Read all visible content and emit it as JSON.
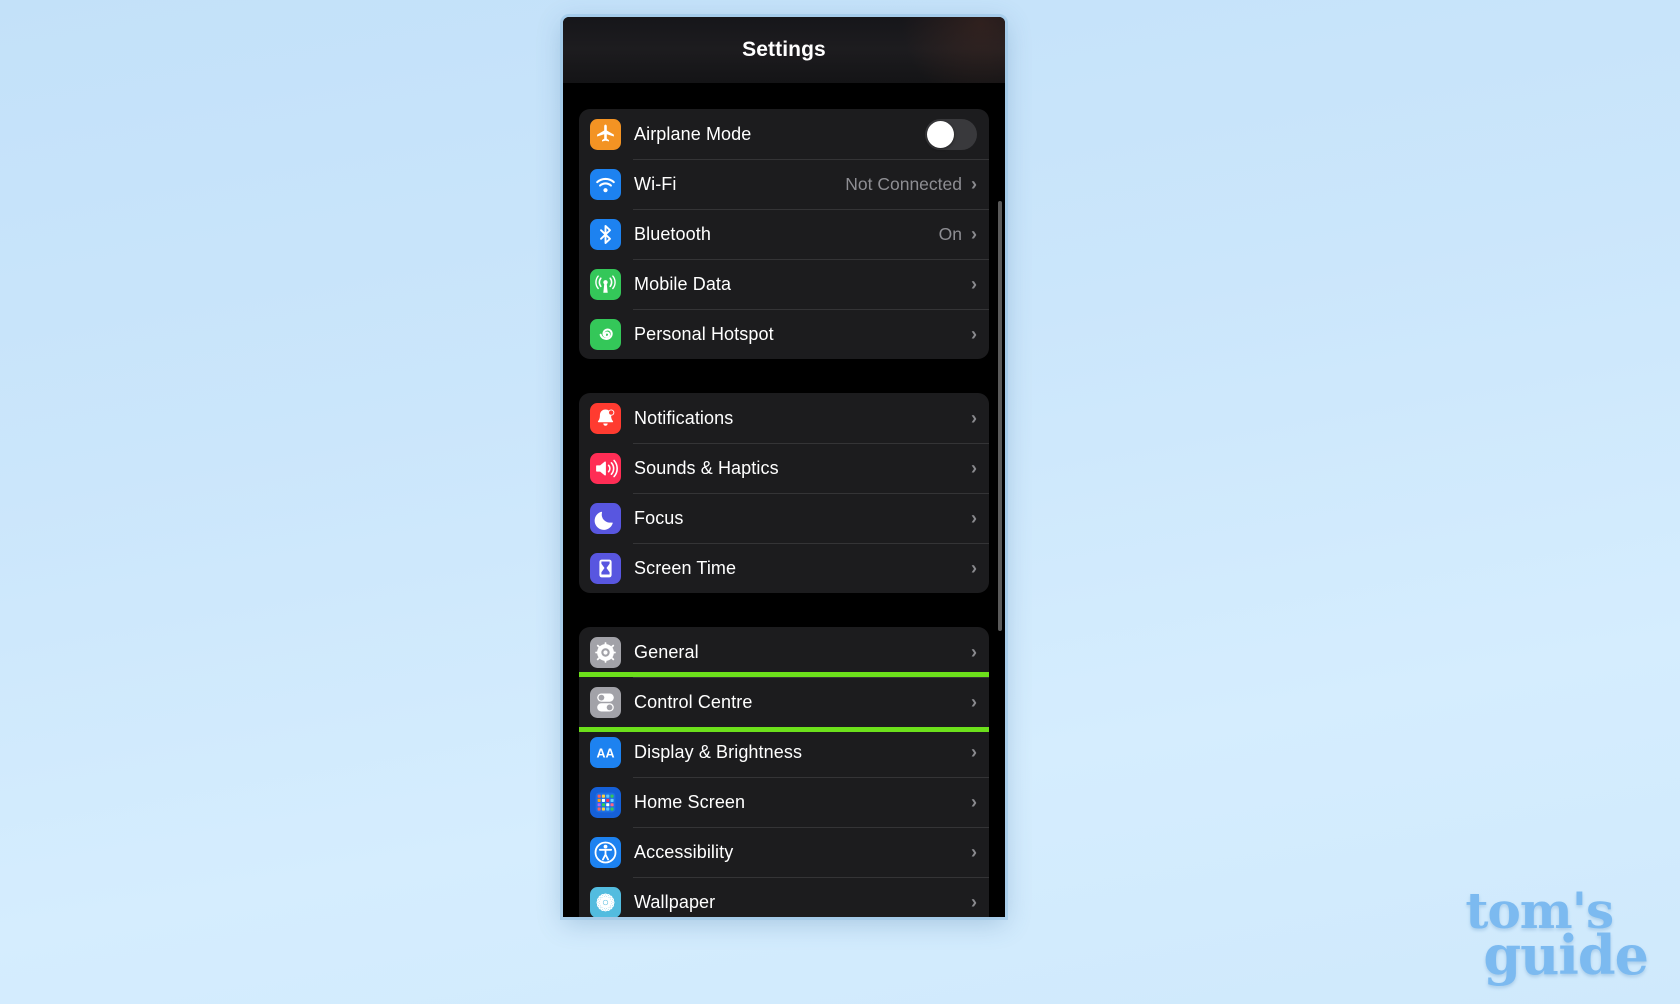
{
  "nav": {
    "title": "Settings"
  },
  "watermark": {
    "line1": "tom's",
    "line2": "guide"
  },
  "icons": {
    "airplane": "airplane-icon",
    "wifi": "wifi-icon",
    "bluetooth": "bluetooth-icon",
    "mobile_data": "cellular-antenna-icon",
    "hotspot": "personal-hotspot-icon",
    "notifications": "bell-icon",
    "sounds": "speaker-waves-icon",
    "focus": "moon-icon",
    "screen_time": "hourglass-icon",
    "general": "gear-icon",
    "control_centre": "toggles-icon",
    "display": "aa-icon",
    "home_screen": "app-grid-icon",
    "accessibility": "accessibility-person-icon",
    "wallpaper": "flower-icon",
    "chevron": "chevron-right-icon"
  },
  "colors": {
    "highlight": "#6ce01b",
    "background_top": "#c3e1f9",
    "background_bottom": "#d5edfe",
    "group_bg": "#1c1c1e",
    "value_text": "#8e8e93",
    "watermark": "#7cbaf0",
    "orange": "#f39323",
    "blue": "#1d82f0",
    "green": "#34c759",
    "red": "#ff3b30",
    "pink": "#ff2d55",
    "indigo": "#5856e0",
    "gray": "#a2a2a8",
    "teal": "#53bcdf"
  },
  "chevron_glyph": "›",
  "groups": [
    {
      "name": "connectivity",
      "rows": [
        {
          "label": "Airplane Mode",
          "icon": "airplane",
          "accessory": "toggle",
          "toggle_on": false,
          "value": ""
        },
        {
          "label": "Wi-Fi",
          "icon": "wifi",
          "accessory": "chevron",
          "value": "Not Connected"
        },
        {
          "label": "Bluetooth",
          "icon": "bluetooth",
          "accessory": "chevron",
          "value": "On"
        },
        {
          "label": "Mobile Data",
          "icon": "mobile_data",
          "accessory": "chevron",
          "value": ""
        },
        {
          "label": "Personal Hotspot",
          "icon": "hotspot",
          "accessory": "chevron",
          "value": ""
        }
      ]
    },
    {
      "name": "alerts",
      "rows": [
        {
          "label": "Notifications",
          "icon": "notifications",
          "accessory": "chevron",
          "value": ""
        },
        {
          "label": "Sounds & Haptics",
          "icon": "sounds",
          "accessory": "chevron",
          "value": ""
        },
        {
          "label": "Focus",
          "icon": "focus",
          "accessory": "chevron",
          "value": ""
        },
        {
          "label": "Screen Time",
          "icon": "screen_time",
          "accessory": "chevron",
          "value": ""
        }
      ]
    },
    {
      "name": "system",
      "rows": [
        {
          "label": "General",
          "icon": "general",
          "accessory": "chevron",
          "value": ""
        },
        {
          "label": "Control Centre",
          "icon": "control_centre",
          "accessory": "chevron",
          "value": "",
          "highlighted": true
        },
        {
          "label": "Display & Brightness",
          "icon": "display",
          "accessory": "chevron",
          "value": ""
        },
        {
          "label": "Home Screen",
          "icon": "home_screen",
          "accessory": "chevron",
          "value": ""
        },
        {
          "label": "Accessibility",
          "icon": "accessibility",
          "accessory": "chevron",
          "value": ""
        },
        {
          "label": "Wallpaper",
          "icon": "wallpaper",
          "accessory": "chevron",
          "value": ""
        }
      ]
    }
  ]
}
